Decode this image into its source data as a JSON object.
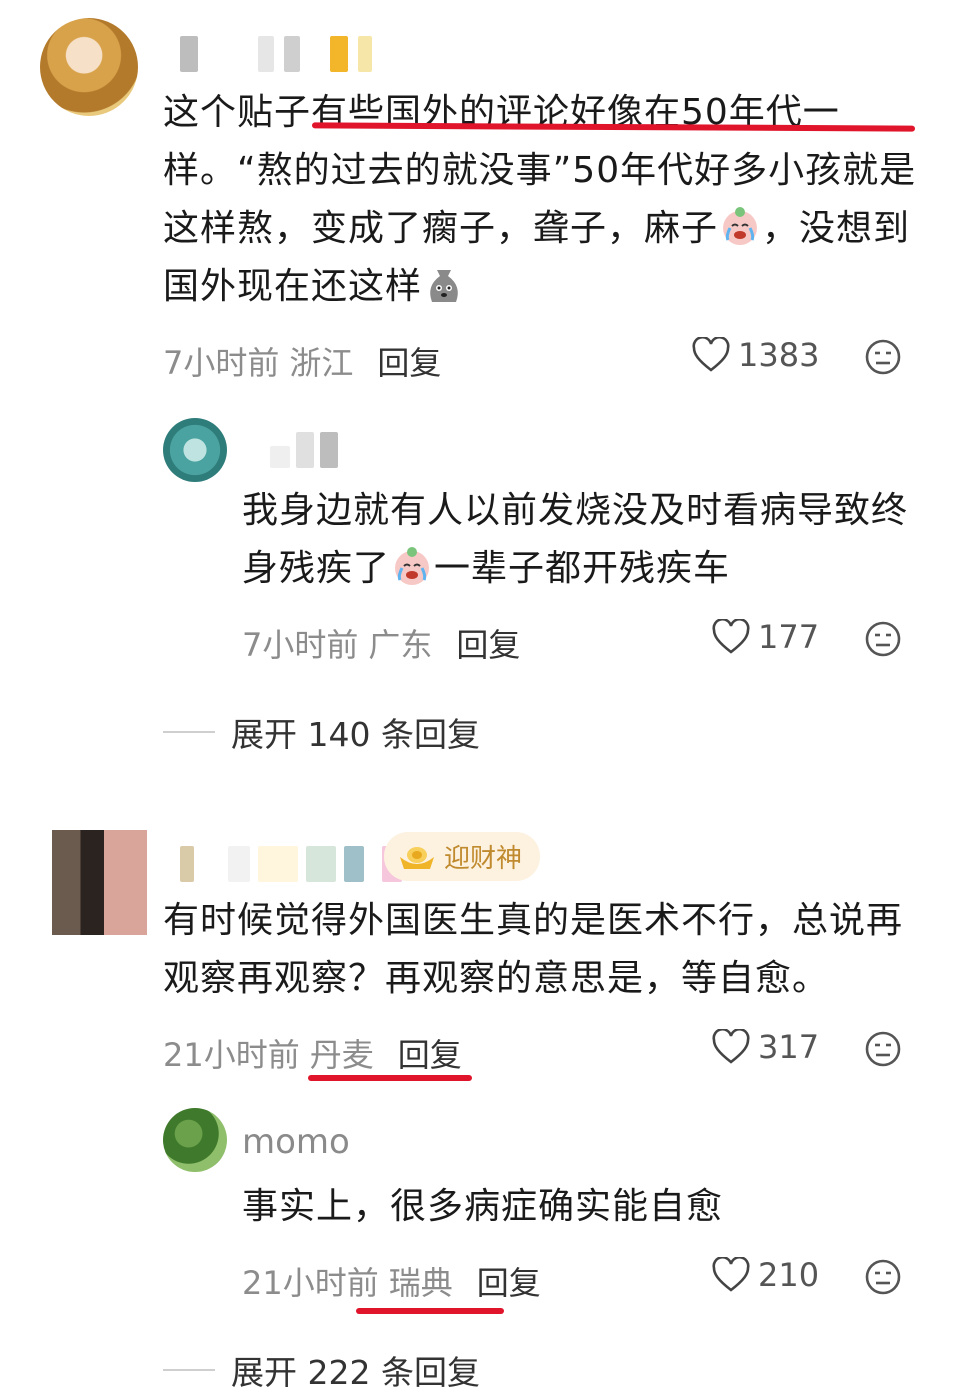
{
  "comments": [
    {
      "text_parts": [
        "这个贴子有些国外的评论好像在50年代一样。“熬的过去的就没事”50年代好多小孩就是这样熬，变成了瘸子，聋子，麻子",
        "，没想到国外现在还这样"
      ],
      "time": "7小时前",
      "location": "浙江",
      "reply_label": "回复",
      "likes": "1383",
      "reply": {
        "text_parts": [
          "我身边就有人以前发烧没及时看病导致终身残疾了",
          "一辈子都开残疾车"
        ],
        "time": "7小时前",
        "location": "广东",
        "reply_label": "回复",
        "likes": "177"
      },
      "expand_label": "展开 140 条回复"
    },
    {
      "badge": "迎财神",
      "text": "有时候觉得外国医生真的是医术不行，总说再观察再观察？再观察的意思是，等自愈。",
      "time": "21小时前",
      "location": "丹麦",
      "reply_label": "回复",
      "likes": "317",
      "reply": {
        "username": "momo",
        "text": "事实上，很多病症确实能自愈",
        "time": "21小时前",
        "location": "瑞典",
        "reply_label": "回复",
        "likes": "210"
      },
      "expand_label": "展开 222 条回复"
    }
  ],
  "icons": {
    "like": "heart-outline-icon",
    "react": "emoji-react-icon",
    "badge": "gold-ingot-icon"
  },
  "colors": {
    "annotation": "#e0142a",
    "badge_bg": "#fdf1df",
    "badge_text": "#c08a2e"
  }
}
